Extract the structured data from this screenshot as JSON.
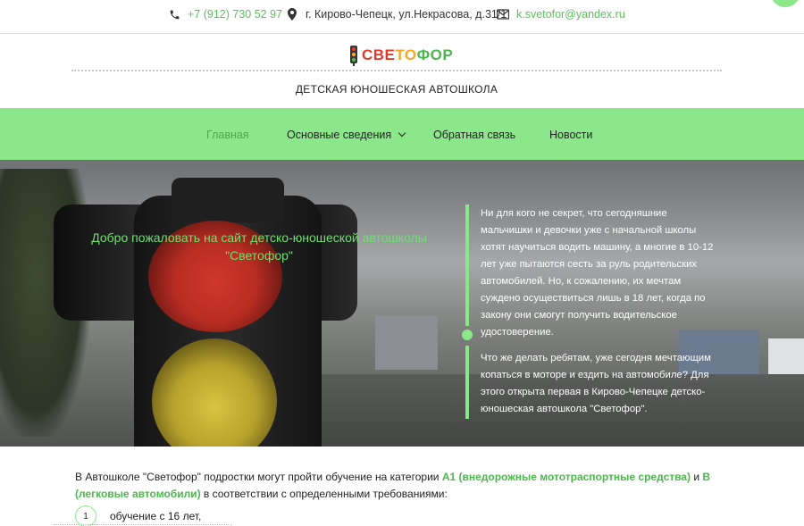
{
  "contacts": {
    "phone": "+7 (912) 730 52 97",
    "address": "г. Кирово-Чепецк, ул.Некрасова, д.31/1",
    "email": "k.svetofor@yandex.ru"
  },
  "logo": {
    "part1": "СВЕ",
    "part2": "ТО",
    "part3": "ФОР"
  },
  "subtitle": "ДЕТСКАЯ ЮНОШЕСКАЯ АВТОШКОЛА",
  "nav": {
    "home": "Главная",
    "info": "Основные сведения",
    "feedback": "Обратная связь",
    "news": "Новости"
  },
  "hero": {
    "welcome": "Добро пожаловать на сайт детско-юношеской автошколы \"Светофор\"",
    "paragraph1": "Ни для кого не секрет, что сегодняшние мальчишки и девочки уже с начальной школы хотят научиться водить машину, а многие в 10-12 лет уже пытаются сесть за руль родительских автомобилей. Но, к сожалению, их мечтам суждено осуществиться лишь в 18 лет, когда по закону они смогут получить водительское удостоверение.",
    "paragraph2": "Что же делать ребятам, уже сегодня мечтающим копаться в моторе и ездить на автомобиле? Для этого открыта первая в Кирово-Чепецке детско-юношеская  автошкола \"Светофор\"."
  },
  "content": {
    "intro_start": "В Автошколе  \"Светофор\" подростки могут пройти обучение на категории ",
    "cat_a": "А1 (внедорожные мототраспортные средства)",
    "and": " и  ",
    "cat_b": "В (легковые автомобили)",
    "intro_end": " в соответствии с определенными требованиями:",
    "list": [
      {
        "num": "1",
        "text": "обучение с 16 лет,"
      }
    ]
  },
  "colors": {
    "accent": "#8ae88a",
    "link": "#4cb74c"
  }
}
